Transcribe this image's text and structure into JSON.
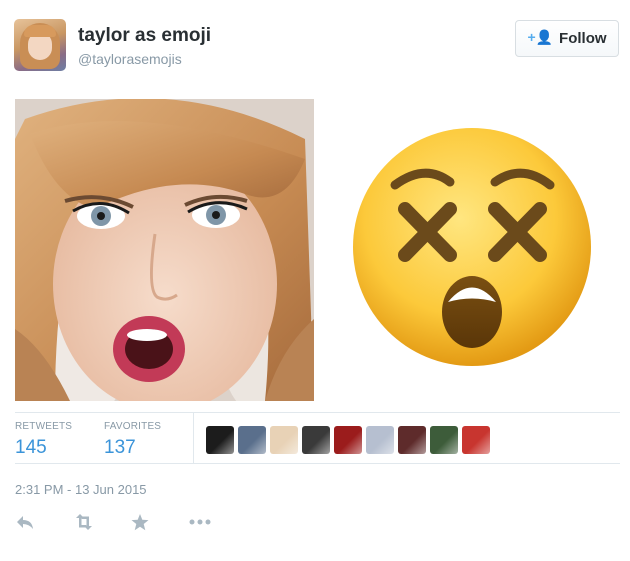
{
  "tweet": {
    "display_name": "taylor as emoji",
    "handle": "@taylorasemojis",
    "follow_label": "Follow",
    "retweets_label": "RETWEETS",
    "retweets_count": "145",
    "favorites_label": "FAVORITES",
    "favorites_count": "137",
    "timestamp": "2:31 PM - 13 Jun 2015"
  },
  "media": {
    "left_image": "selfie-photo",
    "right_image": "dizzy-face-emoji"
  },
  "favoriters": [
    {
      "name": "favoriter-avatar-1",
      "color": "#1c1c1c"
    },
    {
      "name": "favoriter-avatar-2",
      "color": "#5a6f8c"
    },
    {
      "name": "favoriter-avatar-3",
      "color": "#e8d2b6"
    },
    {
      "name": "favoriter-avatar-4",
      "color": "#3a3a3a"
    },
    {
      "name": "favoriter-avatar-5",
      "color": "#9b1c1c"
    },
    {
      "name": "favoriter-avatar-6",
      "color": "#b6bfd0"
    },
    {
      "name": "favoriter-avatar-7",
      "color": "#5e2b2b"
    },
    {
      "name": "favoriter-avatar-8",
      "color": "#3d5c3a"
    },
    {
      "name": "favoriter-avatar-9",
      "color": "#c8352f"
    }
  ],
  "actions": [
    {
      "name": "reply-icon"
    },
    {
      "name": "retweet-icon"
    },
    {
      "name": "favorite-icon"
    },
    {
      "name": "more-icon"
    }
  ],
  "colors": {
    "link_blue": "#3b94d9",
    "muted_gray": "#8899a6",
    "follow_icon_blue": "#55acee",
    "emoji_yellow": "#fcc93a",
    "emoji_brown": "#6b4a1b"
  }
}
